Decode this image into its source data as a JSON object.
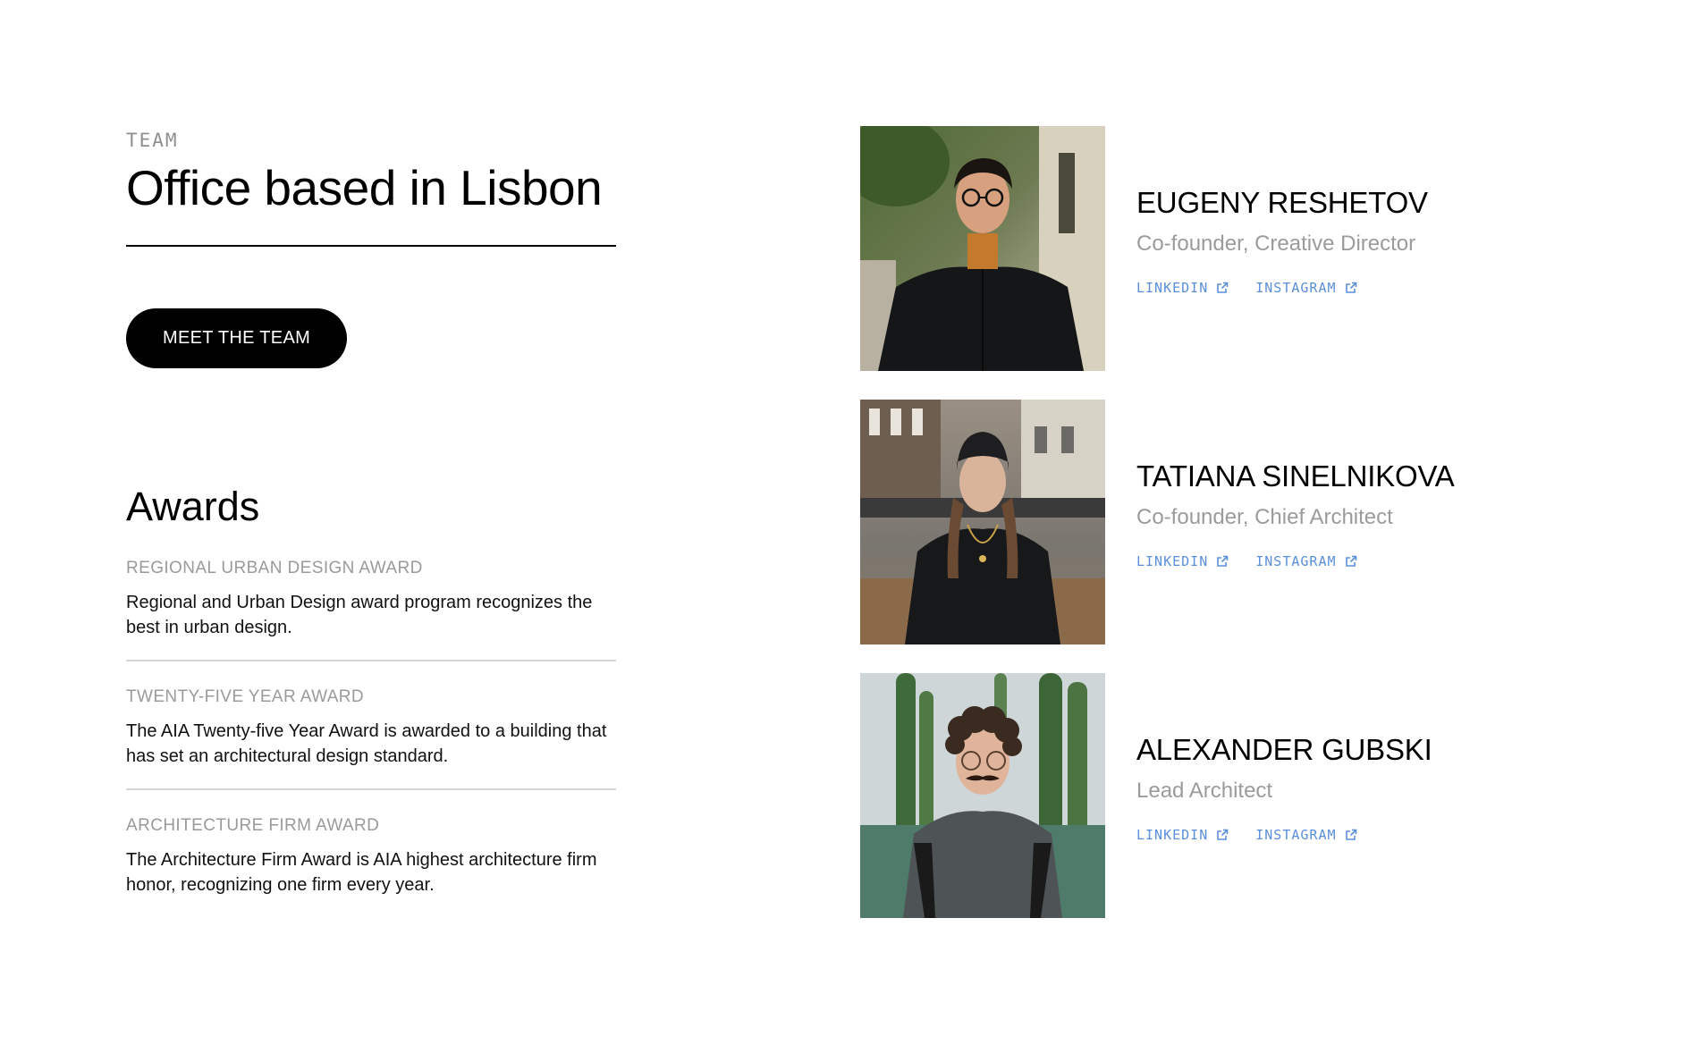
{
  "team_section": {
    "eyebrow": "TEAM",
    "title": "Office based in Lisbon",
    "cta_label": "MEET THE TEAM"
  },
  "awards": {
    "title": "Awards",
    "items": [
      {
        "name": "REGIONAL URBAN DESIGN AWARD",
        "description": "Regional and Urban Design award program recognizes the best in urban design."
      },
      {
        "name": "TWENTY-FIVE YEAR AWARD",
        "description": "The AIA Twenty-five Year Award is awarded to a building that has set an architectural design standard."
      },
      {
        "name": "ARCHITECTURE FIRM AWARD",
        "description": "The Architecture Firm Award is AIA highest architecture firm honor, recognizing one firm every year."
      }
    ]
  },
  "members": [
    {
      "name": "EUGENY RESHETOV",
      "role": "Co-founder, Creative Director",
      "links": [
        {
          "label": "LINKEDIN",
          "icon": "external-link-icon"
        },
        {
          "label": "INSTAGRAM",
          "icon": "external-link-icon"
        }
      ]
    },
    {
      "name": "TATIANA SINELNIKOVA",
      "role": "Co-founder, Chief Architect",
      "links": [
        {
          "label": "LINKEDIN",
          "icon": "external-link-icon"
        },
        {
          "label": "INSTAGRAM",
          "icon": "external-link-icon"
        }
      ]
    },
    {
      "name": "ALEXANDER GUBSKI",
      "role": "Lead Architect",
      "links": [
        {
          "label": "LINKEDIN",
          "icon": "external-link-icon"
        },
        {
          "label": "INSTAGRAM",
          "icon": "external-link-icon"
        }
      ]
    }
  ],
  "colors": {
    "link": "#5b8fdb",
    "muted_text": "#9b9b9b",
    "button_bg": "#000000",
    "button_text": "#ffffff"
  }
}
